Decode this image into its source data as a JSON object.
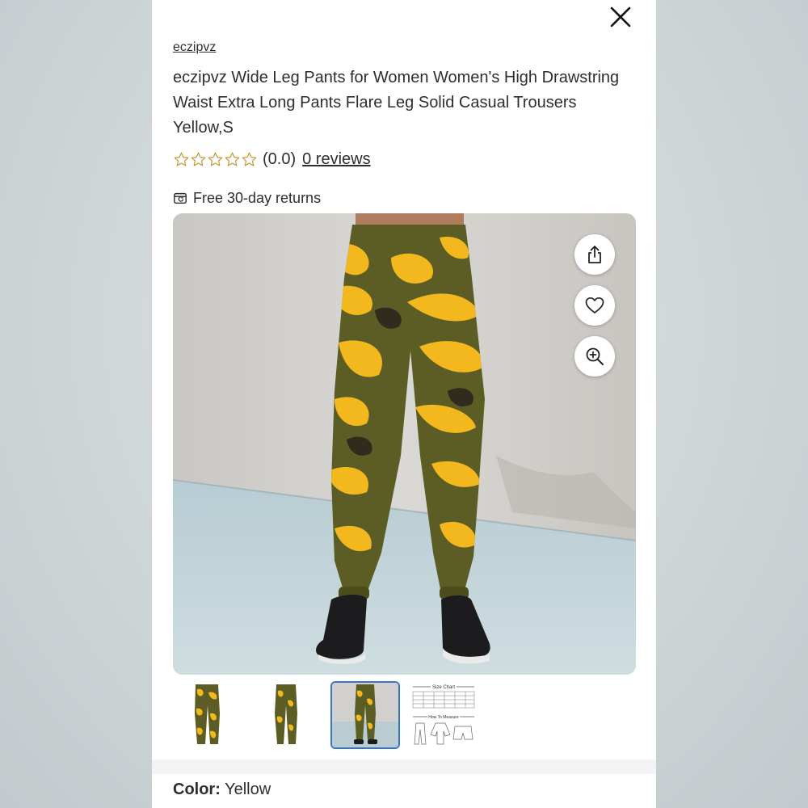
{
  "product": {
    "brand": "eczipvz",
    "title": "eczipvz Wide Leg Pants for Women Women's High Drawstring Waist Extra Long Pants Flare Leg Solid Casual Trousers Yellow,S",
    "rating": 0,
    "rating_display": "(0.0)",
    "reviews_label": "0 reviews",
    "returns_label": "Free 30-day returns"
  },
  "gallery": {
    "selected_index": 2,
    "thumbnail_count": 4,
    "thumb_4_heading": "Size Chart",
    "thumb_4_subheading": "How To Measure",
    "actions": [
      "share-icon",
      "heart-icon",
      "zoom-in-icon"
    ]
  },
  "variant": {
    "color_label": "Color:",
    "color_value": "Yellow"
  },
  "colors": {
    "selected_thumb_border": "#3b73c9",
    "star_outline": "#c79a3a",
    "text": "#2e2e2e"
  }
}
